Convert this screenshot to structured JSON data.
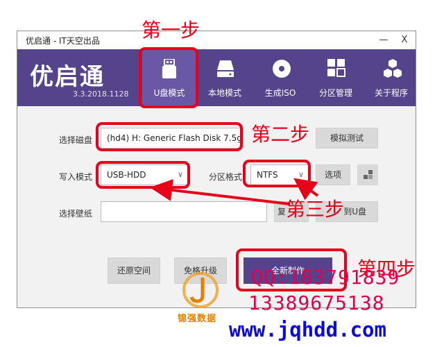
{
  "window": {
    "title": "优启通 - IT天空出品",
    "minimize": "—",
    "close": "X"
  },
  "header": {
    "logo": "优启通",
    "version": "3.3.2018.1128",
    "nav": [
      {
        "label": "U盘模式",
        "icon": "usb-drive-icon"
      },
      {
        "label": "本地模式",
        "icon": "hard-disk-icon"
      },
      {
        "label": "生成ISO",
        "icon": "disc-icon"
      },
      {
        "label": "分区管理",
        "icon": "partition-grid-icon"
      },
      {
        "label": "关于程序",
        "icon": "cubes-icon"
      }
    ]
  },
  "form": {
    "select_disk_label": "选择磁盘",
    "disk_value": "(hd4) H: Generic Flash Disk 7.5g",
    "simulate_test_button": "模拟测试",
    "write_mode_label": "写入模式",
    "write_mode_value": "USB-HDD",
    "partition_format_label": "分区格式",
    "partition_format_value": "NTFS",
    "options_button": "选项",
    "wallpaper_label": "选择壁纸",
    "wallpaper_value": "",
    "copy_button_partial": "到U盘",
    "copy_button_left_partial": "复"
  },
  "actions": {
    "restore_space": "还原空间",
    "free_upgrade": "免格升级",
    "new_create": "全新制作"
  },
  "annotations": {
    "step1": "第一步",
    "step2": "第二步",
    "step3": "第三步",
    "step4": "第四步"
  },
  "watermark": {
    "qq": "QQ:183791839",
    "phone": "13389675138",
    "url": "www.jqhdd.com",
    "brand": "锦强数据"
  },
  "colors": {
    "header": "#55438c",
    "annotation": "#e8001a",
    "watermark_red": "#e0004f",
    "watermark_blue": "#0a0adc"
  }
}
